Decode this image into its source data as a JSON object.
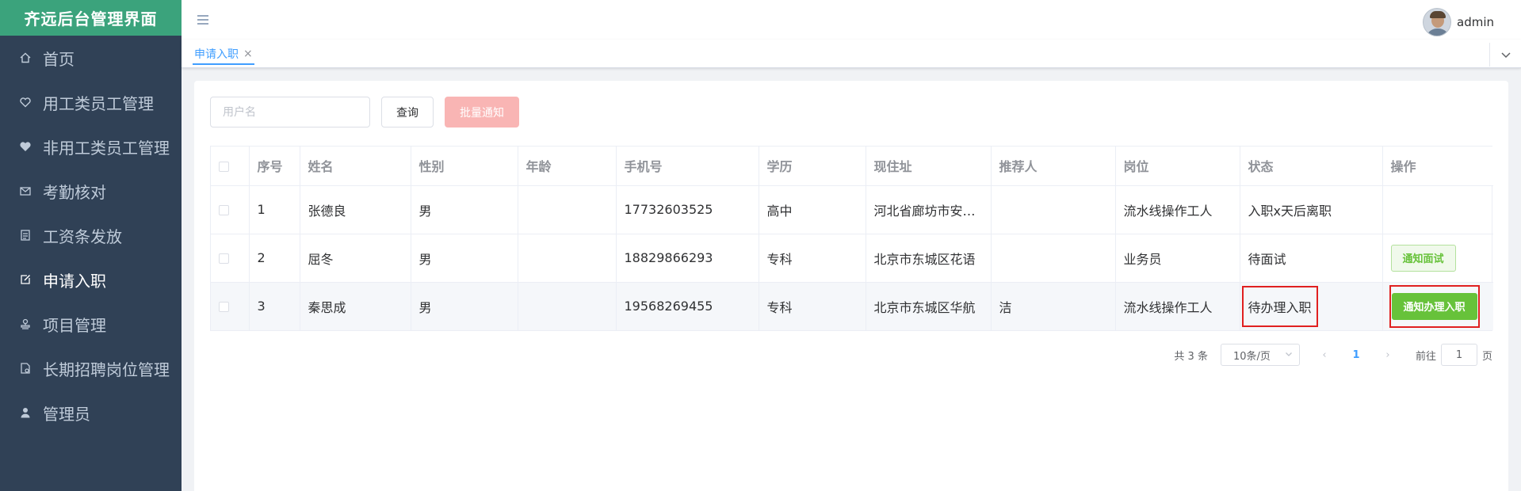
{
  "app": {
    "title": "齐远后台管理界面"
  },
  "sidebar": {
    "items": [
      {
        "label": "首页",
        "icon": "home-icon"
      },
      {
        "label": "用工类员工管理",
        "icon": "heart-outline-icon"
      },
      {
        "label": "非用工类员工管理",
        "icon": "heart-filled-icon"
      },
      {
        "label": "考勤核对",
        "icon": "message-icon"
      },
      {
        "label": "工资条发放",
        "icon": "tickets-icon"
      },
      {
        "label": "申请入职",
        "icon": "edit-icon",
        "active": true
      },
      {
        "label": "项目管理",
        "icon": "stamp-icon"
      },
      {
        "label": "长期招聘岗位管理",
        "icon": "document-icon"
      },
      {
        "label": "管理员",
        "icon": "user-icon"
      }
    ]
  },
  "navbar": {
    "username": "admin"
  },
  "tags": {
    "active_tag": "申请入职"
  },
  "filters": {
    "username_placeholder": "用户名",
    "query_label": "查询",
    "batch_notice_label": "批量通知"
  },
  "table": {
    "columns": [
      "序号",
      "姓名",
      "性别",
      "年龄",
      "手机号",
      "学历",
      "现住址",
      "推荐人",
      "岗位",
      "状态",
      "操作"
    ],
    "rows": [
      {
        "index": "1",
        "name": "张德良",
        "gender": "男",
        "age": "",
        "phone": "17732603525",
        "education": "高中",
        "address": "河北省廊坊市安…",
        "referrer": "",
        "position": "流水线操作工人",
        "status": "入职x天后离职",
        "action": ""
      },
      {
        "index": "2",
        "name": "屈冬",
        "gender": "男",
        "age": "",
        "phone": "18829866293",
        "education": "专科",
        "address": "北京市东城区花语",
        "referrer": "",
        "position": "业务员",
        "status": "待面试",
        "action": "通知面试"
      },
      {
        "index": "3",
        "name": "秦思成",
        "gender": "男",
        "age": "",
        "phone": "19568269455",
        "education": "专科",
        "address": "北京市东城区华航",
        "referrer": "洁",
        "position": "流水线操作工人",
        "status": "待办理入职",
        "action": "通知办理入职"
      }
    ]
  },
  "pagination": {
    "total_text": "共 3 条",
    "page_size": "10条/页",
    "current_page": "1",
    "goto_prefix": "前往",
    "goto_value": "1",
    "goto_suffix": "页"
  },
  "colors": {
    "sidebar_bg": "#304156",
    "brand_bg": "#3ba37c",
    "primary": "#409eff",
    "success": "#67c23a",
    "highlight": "#e02020"
  }
}
